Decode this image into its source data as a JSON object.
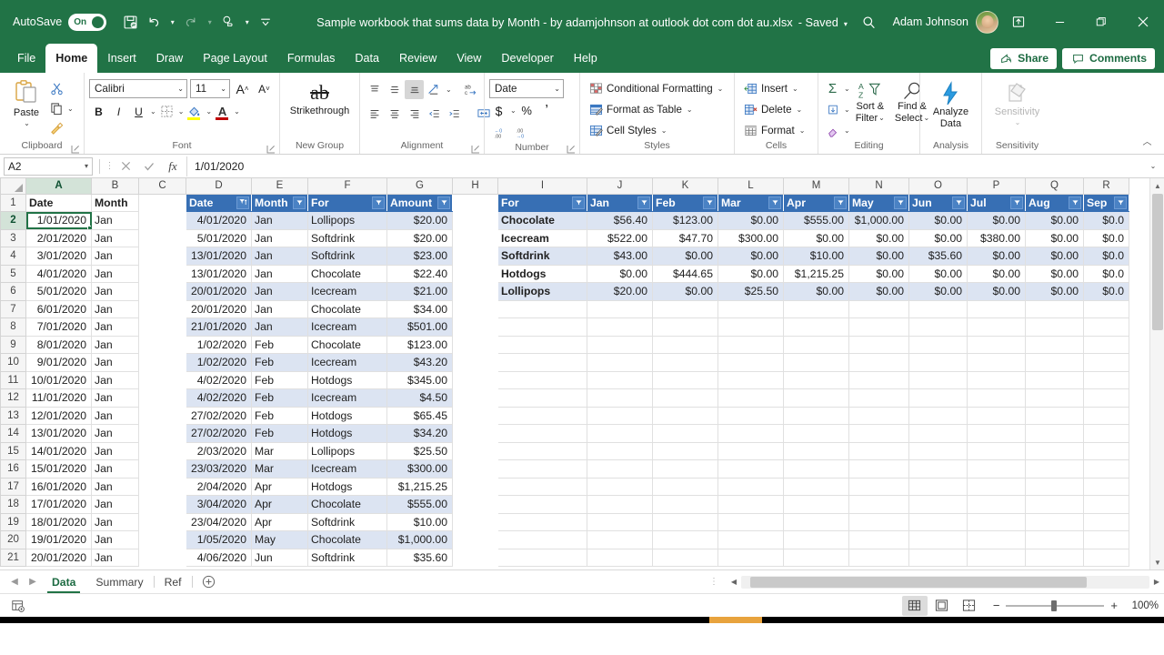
{
  "titlebar": {
    "autosave_label": "AutoSave",
    "autosave_state": "On",
    "document_title": "Sample workbook that sums data by Month - by adamjohnson at outlook dot com dot au.xlsx",
    "save_state": "- Saved",
    "user_name": "Adam Johnson",
    "qat": [
      "save-icon",
      "undo-icon",
      "redo-icon",
      "touch-mode-icon",
      "customize-qat-icon"
    ]
  },
  "ribbon_tabs": [
    {
      "label": "File"
    },
    {
      "label": "Home"
    },
    {
      "label": "Insert"
    },
    {
      "label": "Draw"
    },
    {
      "label": "Page Layout"
    },
    {
      "label": "Formulas"
    },
    {
      "label": "Data"
    },
    {
      "label": "Review"
    },
    {
      "label": "View"
    },
    {
      "label": "Developer"
    },
    {
      "label": "Help"
    }
  ],
  "active_tab": "Home",
  "menu_right": {
    "share_label": "Share",
    "comments_label": "Comments"
  },
  "ribbon": {
    "clipboard": {
      "group_label": "Clipboard",
      "paste_label": "Paste",
      "cut_label": "Cut",
      "copy_label": "Copy",
      "format_painter_label": "Format Painter"
    },
    "font": {
      "group_label": "Font",
      "font_family": "Calibri",
      "font_size": "11",
      "grow_label": "A",
      "shrink_label": "A",
      "bold_label": "B",
      "italic_label": "I",
      "underline_label": "U"
    },
    "new_group": {
      "group_label": "New Group",
      "strikethrough_label": "Strikethrough"
    },
    "alignment": {
      "group_label": "Alignment"
    },
    "number": {
      "group_label": "Number",
      "format": "Date",
      "currency_label": "$",
      "percent_label": "%",
      "comma_label": ","
    },
    "styles": {
      "group_label": "Styles",
      "conditional_formatting_label": "Conditional Formatting",
      "format_as_table_label": "Format as Table",
      "cell_styles_label": "Cell Styles"
    },
    "cells": {
      "group_label": "Cells",
      "insert_label": "Insert",
      "delete_label": "Delete",
      "format_label": "Format"
    },
    "editing": {
      "group_label": "Editing",
      "sort_filter_label": "Sort &\nFilter",
      "find_select_label": "Find &\nSelect"
    },
    "analysis": {
      "group_label": "Analysis",
      "analyze_data_label": "Analyze\nData"
    },
    "sensitivity": {
      "group_label": "Sensitivity",
      "sensitivity_label": "Sensitivity"
    }
  },
  "formula_bar": {
    "name_box": "A2",
    "formula": "1/01/2020"
  },
  "grid": {
    "columns": [
      "A",
      "B",
      "C",
      "D",
      "E",
      "F",
      "G",
      "H",
      "I",
      "J",
      "K",
      "L",
      "M",
      "N",
      "O",
      "P",
      "Q",
      "R"
    ],
    "selected_column": "A",
    "selected_row": "2",
    "selected_cell": "A2",
    "rows": [
      "1",
      "2",
      "3",
      "4",
      "5",
      "6",
      "7",
      "8",
      "9",
      "10",
      "11",
      "12",
      "13",
      "14",
      "15",
      "16",
      "17",
      "18",
      "19",
      "20",
      "21"
    ],
    "left_headers": {
      "date": "Date",
      "month": "Month"
    },
    "left_data": [
      {
        "date": "1/01/2020",
        "month": "Jan"
      },
      {
        "date": "2/01/2020",
        "month": "Jan"
      },
      {
        "date": "3/01/2020",
        "month": "Jan"
      },
      {
        "date": "4/01/2020",
        "month": "Jan"
      },
      {
        "date": "5/01/2020",
        "month": "Jan"
      },
      {
        "date": "6/01/2020",
        "month": "Jan"
      },
      {
        "date": "7/01/2020",
        "month": "Jan"
      },
      {
        "date": "8/01/2020",
        "month": "Jan"
      },
      {
        "date": "9/01/2020",
        "month": "Jan"
      },
      {
        "date": "10/01/2020",
        "month": "Jan"
      },
      {
        "date": "11/01/2020",
        "month": "Jan"
      },
      {
        "date": "12/01/2020",
        "month": "Jan"
      },
      {
        "date": "13/01/2020",
        "month": "Jan"
      },
      {
        "date": "14/01/2020",
        "month": "Jan"
      },
      {
        "date": "15/01/2020",
        "month": "Jan"
      },
      {
        "date": "16/01/2020",
        "month": "Jan"
      },
      {
        "date": "17/01/2020",
        "month": "Jan"
      },
      {
        "date": "18/01/2020",
        "month": "Jan"
      },
      {
        "date": "19/01/2020",
        "month": "Jan"
      },
      {
        "date": "20/01/2020",
        "month": "Jan"
      }
    ],
    "main_table": {
      "headers": [
        "Date",
        "Month",
        "For",
        "Amount"
      ],
      "sorted_column": "Date",
      "rows": [
        [
          "4/01/2020",
          "Jan",
          "Lollipops",
          "$20.00"
        ],
        [
          "5/01/2020",
          "Jan",
          "Softdrink",
          "$20.00"
        ],
        [
          "13/01/2020",
          "Jan",
          "Softdrink",
          "$23.00"
        ],
        [
          "13/01/2020",
          "Jan",
          "Chocolate",
          "$22.40"
        ],
        [
          "20/01/2020",
          "Jan",
          "Icecream",
          "$21.00"
        ],
        [
          "20/01/2020",
          "Jan",
          "Chocolate",
          "$34.00"
        ],
        [
          "21/01/2020",
          "Jan",
          "Icecream",
          "$501.00"
        ],
        [
          "1/02/2020",
          "Feb",
          "Chocolate",
          "$123.00"
        ],
        [
          "1/02/2020",
          "Feb",
          "Icecream",
          "$43.20"
        ],
        [
          "4/02/2020",
          "Feb",
          "Hotdogs",
          "$345.00"
        ],
        [
          "4/02/2020",
          "Feb",
          "Icecream",
          "$4.50"
        ],
        [
          "27/02/2020",
          "Feb",
          "Hotdogs",
          "$65.45"
        ],
        [
          "27/02/2020",
          "Feb",
          "Hotdogs",
          "$34.20"
        ],
        [
          "2/03/2020",
          "Mar",
          "Lollipops",
          "$25.50"
        ],
        [
          "23/03/2020",
          "Mar",
          "Icecream",
          "$300.00"
        ],
        [
          "2/04/2020",
          "Apr",
          "Hotdogs",
          "$1,215.25"
        ],
        [
          "3/04/2020",
          "Apr",
          "Chocolate",
          "$555.00"
        ],
        [
          "23/04/2020",
          "Apr",
          "Softdrink",
          "$10.00"
        ],
        [
          "1/05/2020",
          "May",
          "Chocolate",
          "$1,000.00"
        ],
        [
          "4/06/2020",
          "Jun",
          "Softdrink",
          "$35.60"
        ]
      ]
    },
    "summary_table": {
      "headers": [
        "For",
        "Jan",
        "Feb",
        "Mar",
        "Apr",
        "May",
        "Jun",
        "Jul",
        "Aug",
        "Sep"
      ],
      "rows": [
        [
          "Chocolate",
          "$56.40",
          "$123.00",
          "$0.00",
          "$555.00",
          "$1,000.00",
          "$0.00",
          "$0.00",
          "$0.00",
          "$0.0"
        ],
        [
          "Icecream",
          "$522.00",
          "$47.70",
          "$300.00",
          "$0.00",
          "$0.00",
          "$0.00",
          "$380.00",
          "$0.00",
          "$0.0"
        ],
        [
          "Softdrink",
          "$43.00",
          "$0.00",
          "$0.00",
          "$10.00",
          "$0.00",
          "$35.60",
          "$0.00",
          "$0.00",
          "$0.0"
        ],
        [
          "Hotdogs",
          "$0.00",
          "$444.65",
          "$0.00",
          "$1,215.25",
          "$0.00",
          "$0.00",
          "$0.00",
          "$0.00",
          "$0.0"
        ],
        [
          "Lollipops",
          "$20.00",
          "$0.00",
          "$25.50",
          "$0.00",
          "$0.00",
          "$0.00",
          "$0.00",
          "$0.00",
          "$0.0"
        ]
      ]
    }
  },
  "sheet_tabs": [
    {
      "label": "Data",
      "active": true
    },
    {
      "label": "Summary",
      "active": false
    },
    {
      "label": "Ref",
      "active": false
    }
  ],
  "status_bar": {
    "zoom_level": "100%",
    "minus_label": "−",
    "plus_label": "+"
  },
  "colors": {
    "excel_green": "#217346",
    "table_header_blue": "#376fb4",
    "band_blue": "#dce4f2",
    "selection_green": "#217346"
  }
}
